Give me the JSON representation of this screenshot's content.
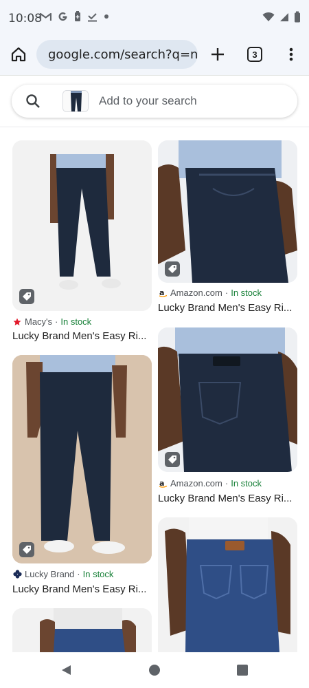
{
  "status_bar": {
    "time": "10:08",
    "notification_icons": [
      "gmail-icon",
      "google-icon",
      "battery-saver-icon",
      "download-done-icon",
      "dot-icon"
    ],
    "system_icons": [
      "wifi-icon",
      "cell-signal-icon",
      "battery-icon"
    ]
  },
  "toolbar": {
    "url": "google.com/search?q=n",
    "tab_count": "3"
  },
  "search": {
    "placeholder": "Add to your search"
  },
  "results": [
    {
      "source": "Macy's",
      "stock": "In stock",
      "title": "Lucky Brand Men's Easy Ri...",
      "logo": "macys-star-icon",
      "logo_color": "#e21a2c"
    },
    {
      "source": "Amazon.com",
      "stock": "In stock",
      "title": "Lucky Brand Men's Easy Ri...",
      "logo": "amazon-icon",
      "logo_color": "#ff9900"
    },
    {
      "source": "Lucky Brand",
      "stock": "In stock",
      "title": "Lucky Brand Men's Easy Ri...",
      "logo": "clover-icon",
      "logo_color": "#1a2b57"
    },
    {
      "source": "Amazon.com",
      "stock": "In stock",
      "title": "Lucky Brand Men's Easy Ri...",
      "logo": "amazon-icon",
      "logo_color": "#ff9900"
    }
  ],
  "colors": {
    "stock_green": "#188038",
    "omnibox_bg": "#dfe7f1",
    "chrome_bg": "#f3f6fb",
    "denim_dark": "#1e2a3d",
    "denim_medium": "#2f4e86",
    "shirt_blue": "#a9bfdc"
  }
}
